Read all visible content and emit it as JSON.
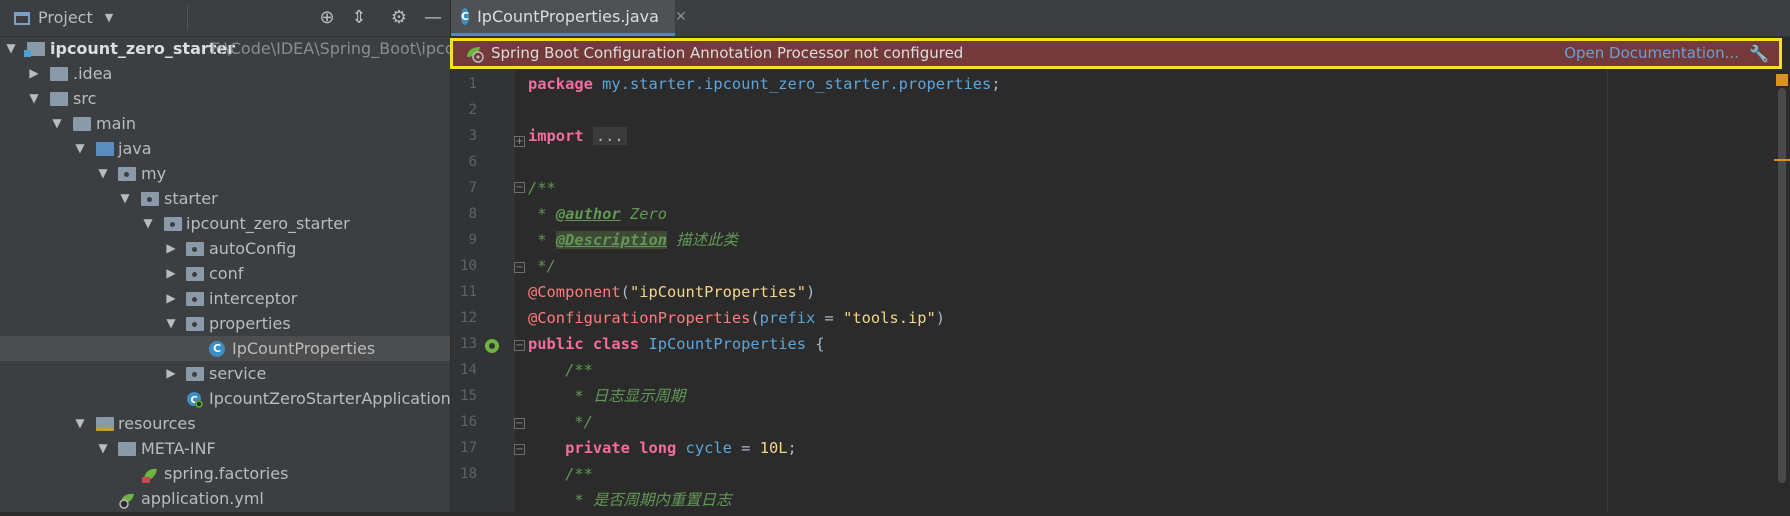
{
  "project_panel": {
    "title": "Project",
    "tree": [
      {
        "label": "ipcount_zero_starter",
        "path": "F:\\Code\\IDEA\\Spring_Boot\\ipcou",
        "depth": 0,
        "expanded": true,
        "icon": "module-folder-icon"
      },
      {
        "label": ".idea",
        "depth": 1,
        "expanded": false,
        "icon": "folder-icon"
      },
      {
        "label": "src",
        "depth": 1,
        "expanded": true,
        "icon": "folder-icon"
      },
      {
        "label": "main",
        "depth": 2,
        "expanded": true,
        "icon": "folder-icon"
      },
      {
        "label": "java",
        "depth": 3,
        "expanded": true,
        "icon": "source-folder-icon"
      },
      {
        "label": "my",
        "depth": 4,
        "expanded": true,
        "icon": "package-icon"
      },
      {
        "label": "starter",
        "depth": 5,
        "expanded": true,
        "icon": "package-icon"
      },
      {
        "label": "ipcount_zero_starter",
        "depth": 6,
        "expanded": true,
        "icon": "package-icon"
      },
      {
        "label": "autoConfig",
        "depth": 7,
        "expanded": false,
        "icon": "package-icon"
      },
      {
        "label": "conf",
        "depth": 7,
        "expanded": false,
        "icon": "package-icon"
      },
      {
        "label": "interceptor",
        "depth": 7,
        "expanded": false,
        "icon": "package-icon"
      },
      {
        "label": "properties",
        "depth": 7,
        "expanded": true,
        "icon": "package-icon"
      },
      {
        "label": "IpCountProperties",
        "depth": 8,
        "icon": "class-icon",
        "selected": true
      },
      {
        "label": "service",
        "depth": 7,
        "expanded": false,
        "icon": "package-icon"
      },
      {
        "label": "IpcountZeroStarterApplication",
        "depth": 7,
        "icon": "spring-boot-class-icon"
      },
      {
        "label": "resources",
        "depth": 3,
        "expanded": true,
        "icon": "resources-folder-icon"
      },
      {
        "label": "META-INF",
        "depth": 4,
        "expanded": true,
        "icon": "folder-icon"
      },
      {
        "label": "spring.factories",
        "depth": 5,
        "icon": "spring-factories-icon"
      },
      {
        "label": "application.yml",
        "depth": 4,
        "icon": "spring-config-icon"
      }
    ]
  },
  "editor": {
    "tab": {
      "label": "IpCountProperties.java",
      "close": "✕"
    },
    "banner": {
      "message": "Spring Boot Configuration Annotation Processor not configured",
      "link": "Open Documentation...",
      "border_color": "#f5e11f",
      "bg_color": "#743a3a"
    },
    "line_numbers": [
      "1",
      "2",
      "3",
      "6",
      "7",
      "8",
      "9",
      "10",
      "11",
      "12",
      "13",
      "14",
      "15",
      "16",
      "17",
      "18"
    ],
    "code": {
      "l1_kw": "package",
      "l1_pkg": "my.starter.ipcount_zero_starter.properties",
      "l1_end": ";",
      "l3_kw": "import",
      "l3_fold": "...",
      "l6": "/**",
      "l7_pre": " * ",
      "l7_tag": "@author",
      "l7_txt": " Zero",
      "l8_pre": " * ",
      "l8_tag": "@Description",
      "l8_txt": " 描述此类",
      "l9": " */",
      "l10_ann": "@Component",
      "l10_open": "(",
      "l10_str": "\"ipCountProperties\"",
      "l10_close": ")",
      "l11_ann": "@ConfigurationProperties",
      "l11_open": "(",
      "l11_param": "prefix",
      "l11_eq": " = ",
      "l11_str": "\"tools.ip\"",
      "l11_close": ")",
      "l12_kw": "public class",
      "l12_cls": "IpCountProperties",
      "l12_brace": " {",
      "l13": "    /**",
      "l14": "     * 日志显示周期",
      "l15": "     */",
      "l16_kw": "    private long",
      "l16_fld": "cycle",
      "l16_eq": " = ",
      "l16_num": "10L",
      "l16_end": ";",
      "l17": "    /**",
      "l18": "     * 是否周期内重置日志"
    }
  }
}
